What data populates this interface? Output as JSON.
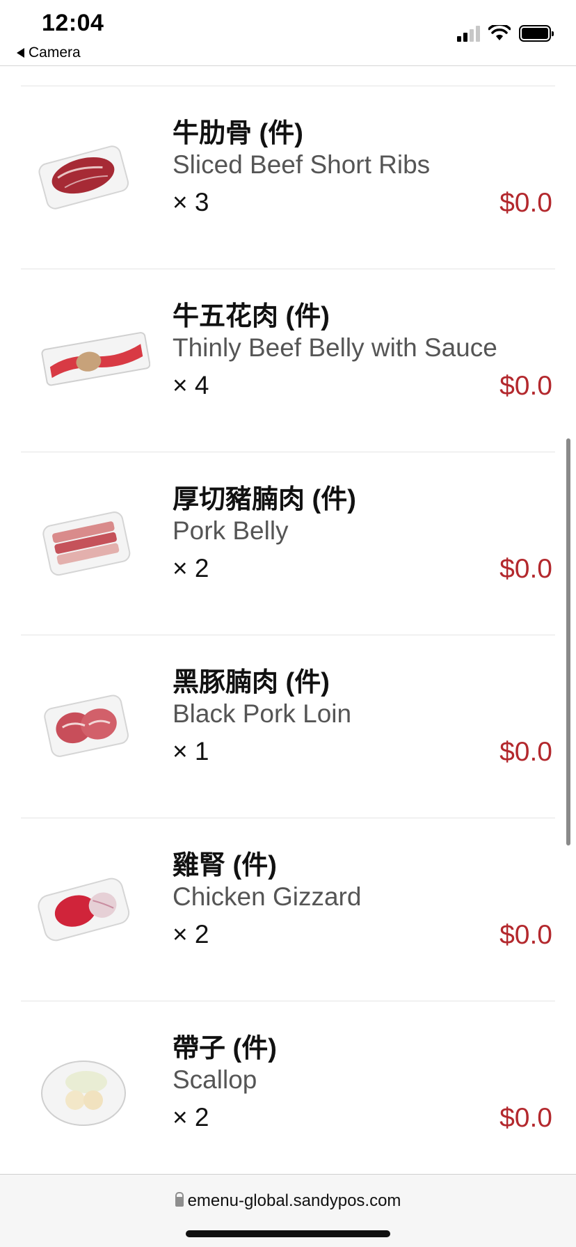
{
  "status_bar": {
    "time": "12:04",
    "back_label": "Camera"
  },
  "items": [
    {
      "zh": "牛肋骨 (件)",
      "en": "Sliced Beef Short Ribs",
      "qty": "× 3",
      "price": "$0.0"
    },
    {
      "zh": "牛五花肉 (件)",
      "en": "Thinly Beef Belly with Sauce",
      "qty": "× 4",
      "price": "$0.0"
    },
    {
      "zh": "厚切豬腩肉 (件)",
      "en": "Pork Belly",
      "qty": "× 2",
      "price": "$0.0"
    },
    {
      "zh": "黑豚腩肉 (件)",
      "en": "Black Pork Loin",
      "qty": "× 1",
      "price": "$0.0"
    },
    {
      "zh": "雞腎 (件)",
      "en": "Chicken Gizzard",
      "qty": "× 2",
      "price": "$0.0"
    },
    {
      "zh": "帶子 (件)",
      "en": "Scallop",
      "qty": "× 2",
      "price": "$0.0"
    }
  ],
  "browser": {
    "url": "emenu-global.sandypos.com"
  },
  "colors": {
    "price": "#b3282d",
    "divider": "#e4e4e4"
  }
}
